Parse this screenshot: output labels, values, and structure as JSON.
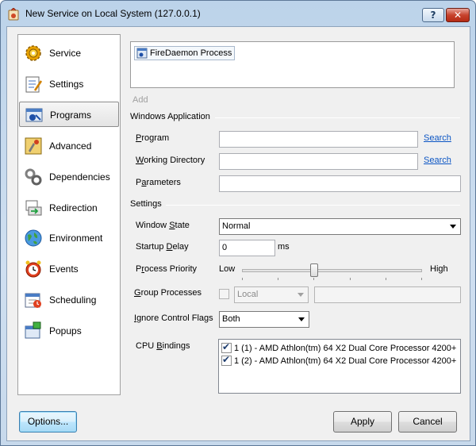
{
  "window": {
    "title": "New Service on Local System (127.0.0.1)",
    "help_label": "?",
    "close_label": "✕"
  },
  "sidebar": {
    "items": [
      {
        "label": "Service",
        "icon": "gear-icon"
      },
      {
        "label": "Settings",
        "icon": "settings-icon"
      },
      {
        "label": "Programs",
        "icon": "programs-icon"
      },
      {
        "label": "Advanced",
        "icon": "advanced-icon"
      },
      {
        "label": "Dependencies",
        "icon": "dependencies-icon"
      },
      {
        "label": "Redirection",
        "icon": "redirection-icon"
      },
      {
        "label": "Environment",
        "icon": "globe-icon"
      },
      {
        "label": "Events",
        "icon": "alarm-clock-icon"
      },
      {
        "label": "Scheduling",
        "icon": "calendar-icon"
      },
      {
        "label": "Popups",
        "icon": "popup-icon"
      }
    ],
    "selected": "Programs"
  },
  "programs": {
    "process_item": "FireDaemon Process",
    "add_label": "Add"
  },
  "windows_application": {
    "heading": "Windows Application",
    "program_label_pre": "",
    "program_label_u": "P",
    "program_label_post": "rogram",
    "program_value": "",
    "working_dir_label_pre": "",
    "working_dir_label_u": "W",
    "working_dir_label_post": "orking Directory",
    "working_dir_value": "",
    "parameters_label_pre": "P",
    "parameters_label_u": "a",
    "parameters_label_post": "rameters",
    "parameters_value": "",
    "search_label": "Search"
  },
  "settings": {
    "heading": "Settings",
    "window_state_label_pre": "Window ",
    "window_state_label_u": "S",
    "window_state_label_post": "tate",
    "window_state_value": "Normal",
    "startup_delay_label_pre": "Startup ",
    "startup_delay_label_u": "D",
    "startup_delay_label_post": "elay",
    "startup_delay_value": "0",
    "startup_delay_unit": "ms",
    "priority_label_pre": "P",
    "priority_label_u": "r",
    "priority_label_post": "ocess Priority",
    "priority_low": "Low",
    "priority_high": "High",
    "priority_level": 0.4,
    "group_label_pre": "",
    "group_label_u": "G",
    "group_label_post": "roup Processes",
    "group_checked": false,
    "group_scope": "Local",
    "group_name": "",
    "ignore_label_pre": "",
    "ignore_label_u": "I",
    "ignore_label_post": "gnore Control Flags",
    "ignore_value": "Both",
    "cpu_label_pre": "CPU ",
    "cpu_label_u": "B",
    "cpu_label_post": "indings",
    "cpu_bindings": [
      {
        "label": "1 (1) - AMD Athlon(tm) 64 X2 Dual Core Processor 4200+",
        "checked": true
      },
      {
        "label": "1 (2) - AMD Athlon(tm) 64 X2 Dual Core Processor 4200+",
        "checked": true
      }
    ]
  },
  "footer": {
    "options_label": "Options...",
    "apply_label": "Apply",
    "cancel_label": "Cancel"
  }
}
